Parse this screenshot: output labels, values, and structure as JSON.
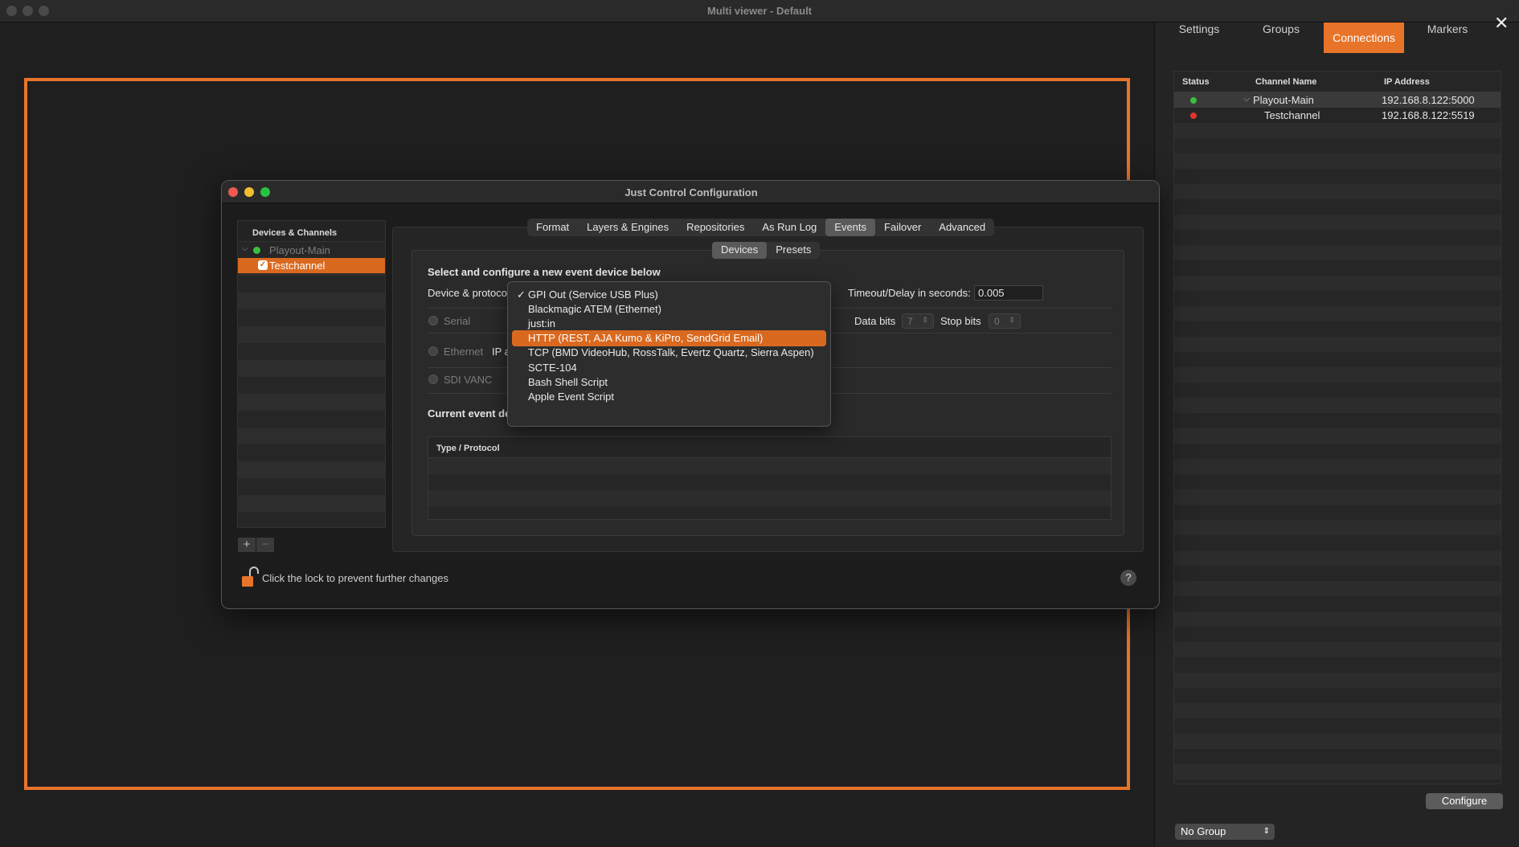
{
  "window": {
    "title": "Multi viewer - Default"
  },
  "right_panel": {
    "tabs": [
      {
        "label": "Settings"
      },
      {
        "label": "Groups"
      },
      {
        "label": "Connections"
      },
      {
        "label": "Markers"
      }
    ],
    "active_tab": "Connections",
    "close_label": "✕",
    "table": {
      "headers": {
        "status": "Status",
        "channel": "Channel Name",
        "ip": "IP Address"
      },
      "rows": [
        {
          "status_color": "#3bbf3b",
          "expand": "⌵",
          "channel": "Playout-Main",
          "ip": "192.168.8.122:5000"
        },
        {
          "status_color": "#e0352b",
          "channel": "Testchannel",
          "ip": "192.168.8.122:5519"
        }
      ]
    },
    "configure_label": "Configure",
    "group_select": "No Group"
  },
  "dialog": {
    "title": "Just Control Configuration",
    "devices_header": "Devices & Channels",
    "devices": [
      {
        "label": "Playout-Main",
        "status_color": "#3bbf3b"
      },
      {
        "label": "Testchannel"
      }
    ],
    "tabs": [
      "Format",
      "Layers & Engines",
      "Repositories",
      "As Run Log",
      "Events",
      "Failover",
      "Advanced"
    ],
    "active_tab": "Events",
    "subtabs": [
      "Devices",
      "Presets"
    ],
    "active_subtab": "Devices",
    "section_title": "Select and configure a new event device below",
    "device_protocol_label": "Device & protoco",
    "timeout_label": "Timeout/Delay in seconds:",
    "timeout_value": "0.005",
    "serial_label": "Serial",
    "data_bits_label": "Data bits",
    "data_bits_value": "7",
    "stop_bits_label": "Stop bits",
    "stop_bits_value": "0",
    "ethernet_label": "Ethernet",
    "ip_label": "IP a",
    "sdi_label": "SDI VANC",
    "current_events_label": "Current event de",
    "events_table_header": "Type / Protocol",
    "lock_text": "Click the lock to prevent further changes",
    "help_label": "?",
    "add_label": "+",
    "remove_label": "−"
  },
  "dropdown": {
    "options": [
      {
        "label": "GPI Out (Service USB Plus)",
        "checked": true
      },
      {
        "label": "Blackmagic ATEM (Ethernet)"
      },
      {
        "label": "just:in"
      },
      {
        "label": "HTTP (REST, AJA Kumo & KiPro, SendGrid Email)",
        "highlighted": true
      },
      {
        "label": "TCP (BMD VideoHub, RossTalk, Evertz Quartz, Sierra Aspen)"
      },
      {
        "label": "SCTE-104"
      },
      {
        "label": "Bash Shell Script"
      },
      {
        "label": "Apple Event Script"
      }
    ]
  },
  "colors": {
    "accent": "#e8742a",
    "selection": "#d9691f",
    "status_ok": "#3bbf3b",
    "status_err": "#e0352b"
  }
}
